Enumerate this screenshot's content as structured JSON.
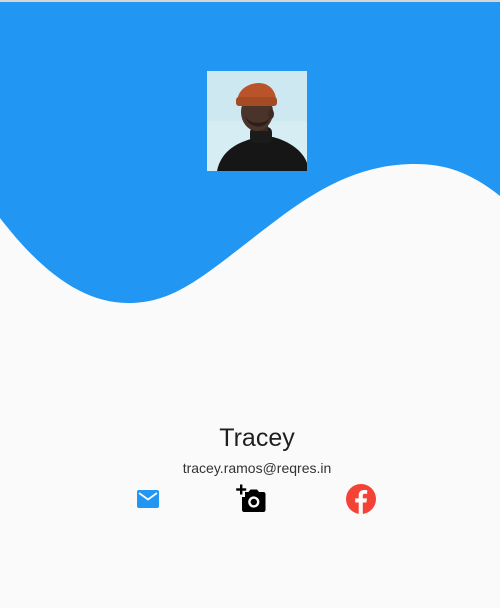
{
  "profile": {
    "name": "Tracey",
    "email": "tracey.ramos@reqres.in"
  },
  "actions": [
    {
      "icon": "mail-icon",
      "color": "#2196f3"
    },
    {
      "icon": "add-a-photo-icon",
      "color": "#000000"
    },
    {
      "icon": "facebook-icon",
      "color": "#f44336"
    }
  ],
  "colors": {
    "header_blue": "#2196f3",
    "background": "#fafafa"
  }
}
